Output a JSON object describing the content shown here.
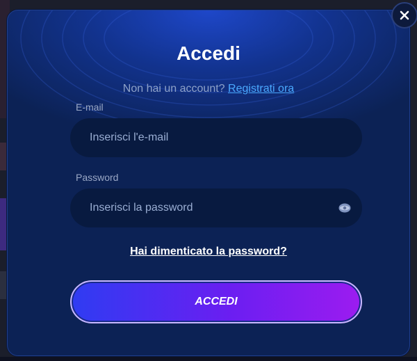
{
  "modal": {
    "title": "Accedi",
    "signup_prompt": "Non hai un account?",
    "signup_link": "Registrati ora",
    "email": {
      "label": "E-mail",
      "placeholder": "Inserisci l'e-mail"
    },
    "password": {
      "label": "Password",
      "placeholder": "Inserisci la password"
    },
    "forgot_link": "Hai dimenticato la password?",
    "submit_label": "ACCEDI"
  },
  "icons": {
    "close": "close-icon",
    "password_toggle": "eye-icon"
  },
  "colors": {
    "modal_bg": "#0c2255",
    "accent_link": "#4aa9ff",
    "button_gradient_start": "#2f3cf2",
    "button_gradient_end": "#9c1cf0"
  }
}
